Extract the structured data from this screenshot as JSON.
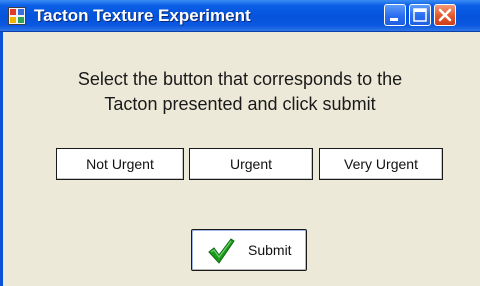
{
  "window": {
    "title": "Tacton Texture Experiment",
    "title_bar_color": "#0553dc",
    "icons": {
      "app": "app-window-icon",
      "minimize": "minimize-icon",
      "maximize": "maximize-icon",
      "close": "close-icon"
    }
  },
  "prompt": {
    "line1": "Select the button that corresponds to the",
    "line2": "Tacton presented and click submit"
  },
  "choices": [
    {
      "label": "Not Urgent"
    },
    {
      "label": "Urgent"
    },
    {
      "label": "Very Urgent"
    }
  ],
  "submit": {
    "label": "Submit",
    "icon": "checkmark-icon",
    "icon_color": "#1c9a1c"
  }
}
